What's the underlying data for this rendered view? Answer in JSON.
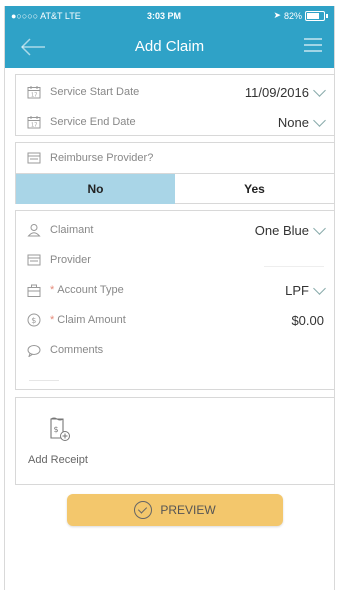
{
  "status": {
    "carrier": "●○○○○ AT&T  LTE",
    "time": "3:03 PM",
    "battery": "82%"
  },
  "header": {
    "title": "Add Claim"
  },
  "dates": {
    "start_label": "Service Start Date",
    "start_value": "11/09/2016",
    "end_label": "Service End Date",
    "end_value": "None"
  },
  "reimburse": {
    "label": "Reimburse Provider?",
    "options": [
      "No",
      "Yes"
    ],
    "selected": "No"
  },
  "claim": {
    "claimant_label": "Claimant",
    "claimant_value": "One Blue",
    "provider_label": "Provider",
    "provider_value": "",
    "account_type_label": "Account Type",
    "account_type_value": "LPF",
    "claim_amount_label": "Claim Amount",
    "claim_amount_value": "$0.00",
    "comments_label": "Comments",
    "required_marker": "*"
  },
  "receipt": {
    "label": "Add Receipt"
  },
  "preview": {
    "label": "PREVIEW"
  },
  "colors": {
    "brand": "#2fa2c7",
    "segment_active": "#a9d5e7",
    "preview_button": "#f3c76c"
  }
}
